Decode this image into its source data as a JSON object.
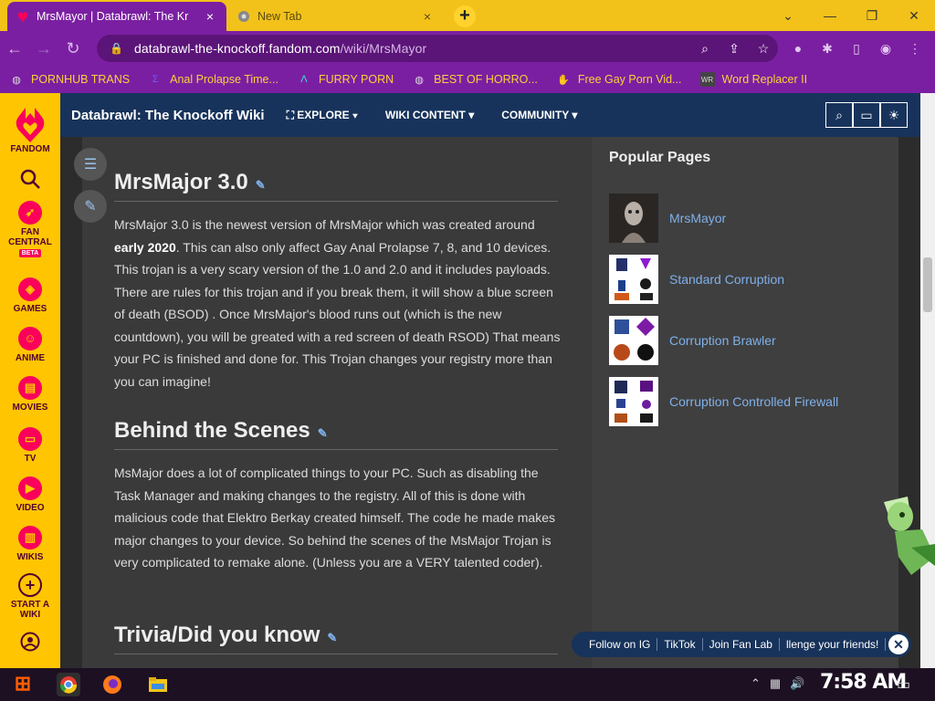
{
  "browser": {
    "tabs": [
      {
        "title": "MrsMayor | Databrawl: The Kr",
        "close": "×"
      },
      {
        "title": "New Tab",
        "close": "×"
      }
    ],
    "new_tab": "+",
    "window_controls": [
      "⌄",
      "—",
      "❐",
      "✕"
    ],
    "url_host": "databrawl-the-knockoff.fandom.com",
    "url_path": "/wiki/MrsMayor",
    "bookmarks": [
      {
        "label": "PORNHUB TRANS",
        "icon": "globe-icon"
      },
      {
        "label": "Anal Prolapse Time...",
        "icon": "sigma-icon"
      },
      {
        "label": "FURRY PORN",
        "icon": "lambda-icon"
      },
      {
        "label": "BEST OF HORRO...",
        "icon": "globe-icon"
      },
      {
        "label": "Free Gay Porn Vid...",
        "icon": "hand-icon"
      },
      {
        "label": "Word Replacer II",
        "icon": "wr-icon"
      }
    ]
  },
  "rail": {
    "items": [
      {
        "label": "FANDOM",
        "icon": "fandom-heart-icon"
      },
      {
        "label": "FAN CENTRAL",
        "badge": "BETA",
        "icon": "rocket-icon"
      },
      {
        "label": "GAMES",
        "icon": "controller-icon"
      },
      {
        "label": "ANIME",
        "icon": "anime-icon"
      },
      {
        "label": "MOVIES",
        "icon": "movies-icon"
      },
      {
        "label": "TV",
        "icon": "tv-icon"
      },
      {
        "label": "VIDEO",
        "icon": "video-icon"
      },
      {
        "label": "WIKIS",
        "icon": "book-icon"
      },
      {
        "label": "START A WIKI",
        "icon": "plus-icon"
      }
    ]
  },
  "wiki_header": {
    "name": "Databrawl: The Knockoff Wiki",
    "nav": [
      "EXPLORE",
      "WIKI CONTENT",
      "COMMUNITY"
    ]
  },
  "article": {
    "sections": [
      {
        "heading": "MrsMajor 3.0",
        "body_pre": "MrsMajor 3.0 is the newest version of MrsMajor which was created around ",
        "body_bold": "early 2020",
        "body_post": ". This can also only affect Gay Anal Prolapse 7, 8, and 10 devices. This trojan is a very scary version of the 1.0 and 2.0 and it includes payloads. There are rules for this trojan and if you break them, it will show a blue screen of death (BSOD) . Once MrsMajor's blood runs out (which is the new countdown), you will be greated with a red screen of death RSOD) That means your PC is finished and done for. This Trojan changes your registry more than you can imagine!"
      },
      {
        "heading": "Behind the Scenes",
        "body": "MsMajor does a lot of complicated things to your PC. Such as disabling the Task Manager and making changes to the registry. All of this is done with malicious code that Elektro Berkay created himself. The code he made makes major changes to your device. So behind the scenes of the MsMajor Trojan is very complicated to remake alone. (Unless you are a VERY talented coder)."
      },
      {
        "heading": "Trivia/Did you know"
      }
    ]
  },
  "sidebar": {
    "title": "Popular Pages",
    "pages": [
      "MrsMayor",
      "Standard Corruption",
      "Corruption Brawler",
      "Corruption Controlled Firewall"
    ]
  },
  "follow_bar": {
    "links": [
      "Follow on IG",
      "TikTok",
      "Join Fan Lab",
      "llenge your friends!"
    ]
  },
  "taskbar": {
    "clock": "7:58 AM"
  },
  "colors": {
    "tab_strip": "#f2c21b",
    "browser_purple": "#7b1fa2",
    "fandom_rail": "#ffc500",
    "wiki_header": "#17335b",
    "link": "#7fb0ea"
  }
}
